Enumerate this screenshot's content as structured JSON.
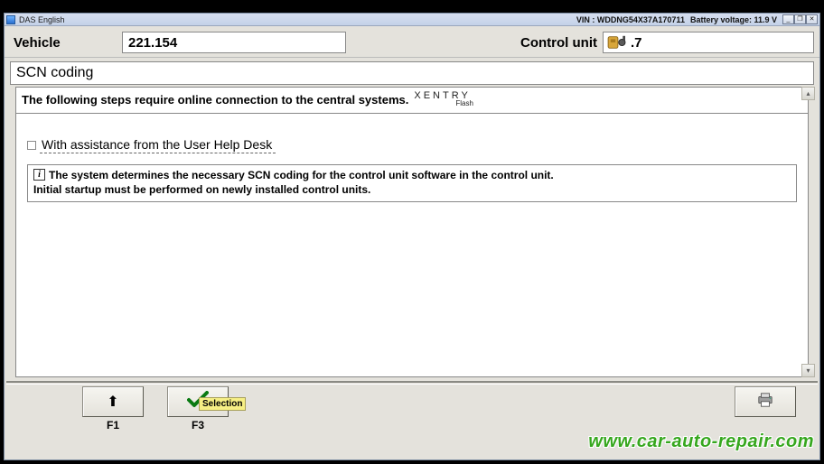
{
  "titlebar": {
    "app_name": "DAS English",
    "vin_label": "VIN : WDDNG54X37A170711",
    "battery_label": "Battery voltage: 11.9 V"
  },
  "header": {
    "vehicle_label": "Vehicle",
    "vehicle_value": "221.154",
    "control_unit_label": "Control unit",
    "control_unit_value": ".7"
  },
  "section": {
    "title": "SCN coding"
  },
  "steps": {
    "text": "The following steps require online connection to the central systems.",
    "logo_top": "XENTRY",
    "logo_sub": "Flash"
  },
  "checkbox": {
    "label": "With assistance from the User Help Desk"
  },
  "info": {
    "icon": "i",
    "line1": "The system determines the necessary SCN coding for the control unit software in the control unit.",
    "line2": "Initial startup must be performed on newly installed control units."
  },
  "fkeys": {
    "f1": "F1",
    "f3": "F3",
    "selection_tooltip": "Selection"
  },
  "watermark": "www.car-auto-repair.com"
}
